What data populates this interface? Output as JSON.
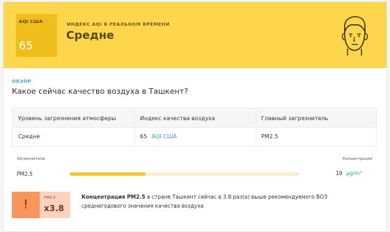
{
  "header": {
    "aqi_label": "AQI США",
    "aqi_value": "65",
    "realtime_label": "ИНДЕКС AQI В РЕАЛЬНОМ ВРЕМЕНИ",
    "status": "Средне",
    "face_icon": "neutral-face-icon",
    "color": "#fdd64b"
  },
  "overview": {
    "section_label": "ОБЗОР",
    "question": "Какое сейчас качество воздуха в Ташкент?"
  },
  "table": {
    "headers": [
      "Уровень загрязнения атмосферы",
      "Индекс качества воздуха",
      "Главный загрязнитель"
    ],
    "row": {
      "level": "Средне",
      "aqi_value": "65",
      "aqi_unit": "AQI США",
      "pollutant": "PM2.5"
    }
  },
  "pollutants": {
    "header_left": "Загрязнители",
    "header_right": "Концентрация",
    "items": [
      {
        "name": "PM2.5",
        "value": "19",
        "unit": "µg/m³",
        "level": 0.33
      }
    ]
  },
  "warning": {
    "pollutant": "PM2.5",
    "multiplier": "x3.8",
    "text_bold": "Концентрация PM2.5",
    "text_rest": " в стране Ташкент сейчас в 3.8 раз(а) выше рекомендуемого ВОЗ среднегодового значения качества воздуха"
  }
}
